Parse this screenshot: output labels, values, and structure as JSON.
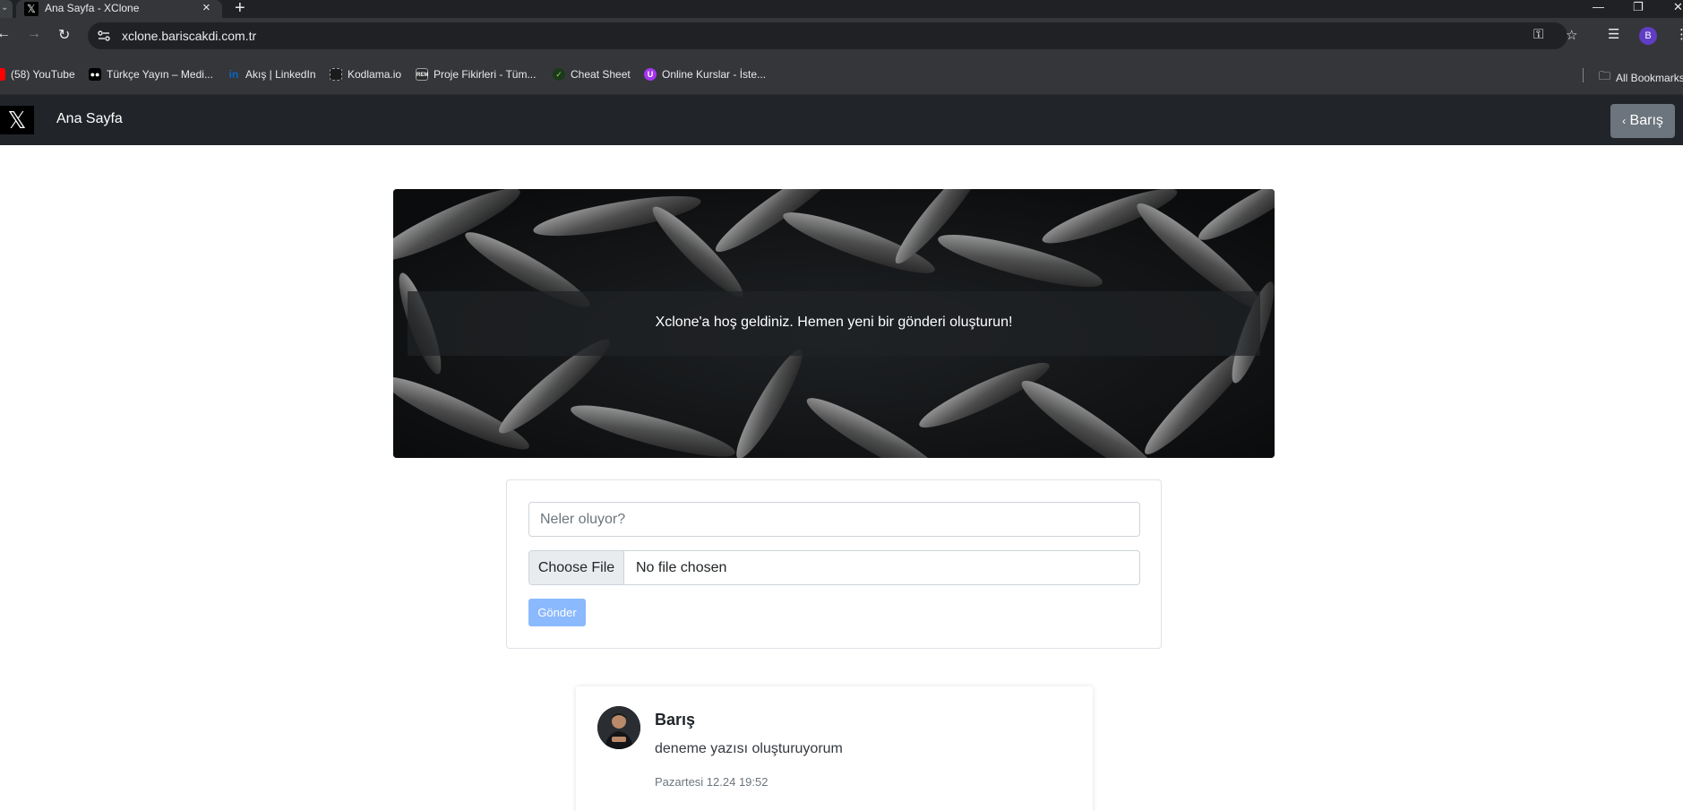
{
  "browser": {
    "tab_title": "Ana Sayfa - XClone",
    "url": "xclone.bariscakdi.com.tr",
    "profile_initial": "B",
    "bookmarks": [
      {
        "label": "(58) YouTube",
        "icon": "youtube-icon",
        "color": "#ff0000"
      },
      {
        "label": "Türkçe Yayın – Medi...",
        "icon": "medium-icon",
        "color": "#000000"
      },
      {
        "label": "Akış | LinkedIn",
        "icon": "linkedin-icon",
        "color": "#0a66c2"
      },
      {
        "label": "Kodlama.io",
        "icon": "kodlama-icon",
        "color": "#1b1b1b"
      },
      {
        "label": "Proje Fikirleri - Tüm...",
        "icon": "rem-icon",
        "color": "#2b2b2b"
      },
      {
        "label": "Cheat Sheet",
        "icon": "cheatsheet-icon",
        "color": "#2e7d32"
      },
      {
        "label": "Online Kurslar - İste...",
        "icon": "udemy-icon",
        "color": "#a435f0"
      }
    ],
    "all_bookmarks": "All Bookmarks"
  },
  "navbar": {
    "brand": "X",
    "title": "Ana Sayfa",
    "user_button": "Barış"
  },
  "hero": {
    "message": "Xclone'a hoş geldiniz. Hemen yeni bir gönderi oluşturun!"
  },
  "form": {
    "post_placeholder": "Neler oluyor?",
    "post_value": "",
    "file_button": "Choose File",
    "file_status": "No file chosen",
    "submit": "Gönder"
  },
  "posts": [
    {
      "author": "Barış",
      "text": "deneme yazısı oluşturuyorum",
      "date": "Pazartesi 12.24 19:52"
    }
  ],
  "colors": {
    "navbar_bg": "#212529",
    "user_button_bg": "#6c757d",
    "submit_disabled_bg": "#8bb9fe",
    "chrome_dark": "#202124",
    "chrome_bar": "#35363a"
  }
}
